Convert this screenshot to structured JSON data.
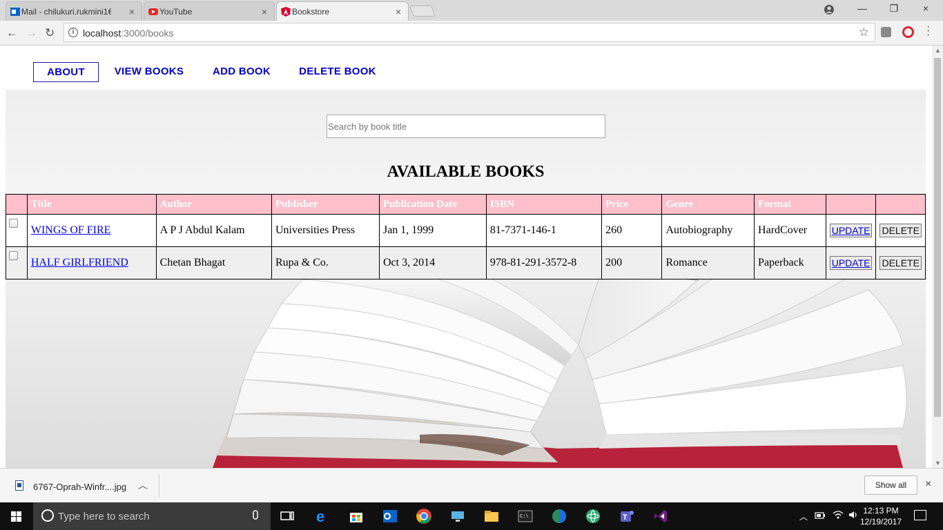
{
  "browser": {
    "tabs": [
      {
        "title": "Mail - chilukuri.rukmini1€",
        "icon": "outlook-icon",
        "active": false
      },
      {
        "title": "YouTube",
        "icon": "youtube-icon",
        "active": false
      },
      {
        "title": "Bookstore",
        "icon": "angular-icon",
        "active": true
      }
    ],
    "url_host": "localhost",
    "url_path": ":3000/books",
    "close_glyph": "×"
  },
  "app": {
    "nav": [
      {
        "label": "ABOUT",
        "selected": true
      },
      {
        "label": "VIEW BOOKS",
        "selected": false
      },
      {
        "label": "ADD BOOK",
        "selected": false
      },
      {
        "label": "DELETE BOOK",
        "selected": false
      }
    ],
    "search_placeholder": "Search by book title",
    "heading": "AVAILABLE BOOKS",
    "table": {
      "headers": [
        "",
        "Title",
        "Author",
        "Publisher",
        "Publication Date",
        "ISBN",
        "Price",
        "Genre",
        "Format",
        "",
        ""
      ],
      "rows": [
        {
          "title": "WINGS OF FIRE",
          "author": "A P J Abdul Kalam",
          "publisher": "Universities Press",
          "date": "Jan 1, 1999",
          "isbn": "81-7371-146-1",
          "price": "260",
          "genre": "Autobiography",
          "format": "HardCover"
        },
        {
          "title": "HALF GIRLFRIEND",
          "author": "Chetan Bhagat",
          "publisher": "Rupa & Co.",
          "date": "Oct 3, 2014",
          "isbn": "978-81-291-3572-8",
          "price": "200",
          "genre": "Romance",
          "format": "Paperback"
        }
      ],
      "update_label": "UPDATE",
      "delete_label": "DELETE"
    }
  },
  "download_bar": {
    "filename": "6767-Oprah-Winfr....jpg",
    "show_all": "Show all"
  },
  "taskbar": {
    "search_placeholder": "Type here to search",
    "time": "12:13 PM",
    "date": "12/19/2017"
  },
  "colors": {
    "nav_link": "#0000cc",
    "table_header_bg": "#ffc0cb",
    "link": "#0000ee"
  }
}
